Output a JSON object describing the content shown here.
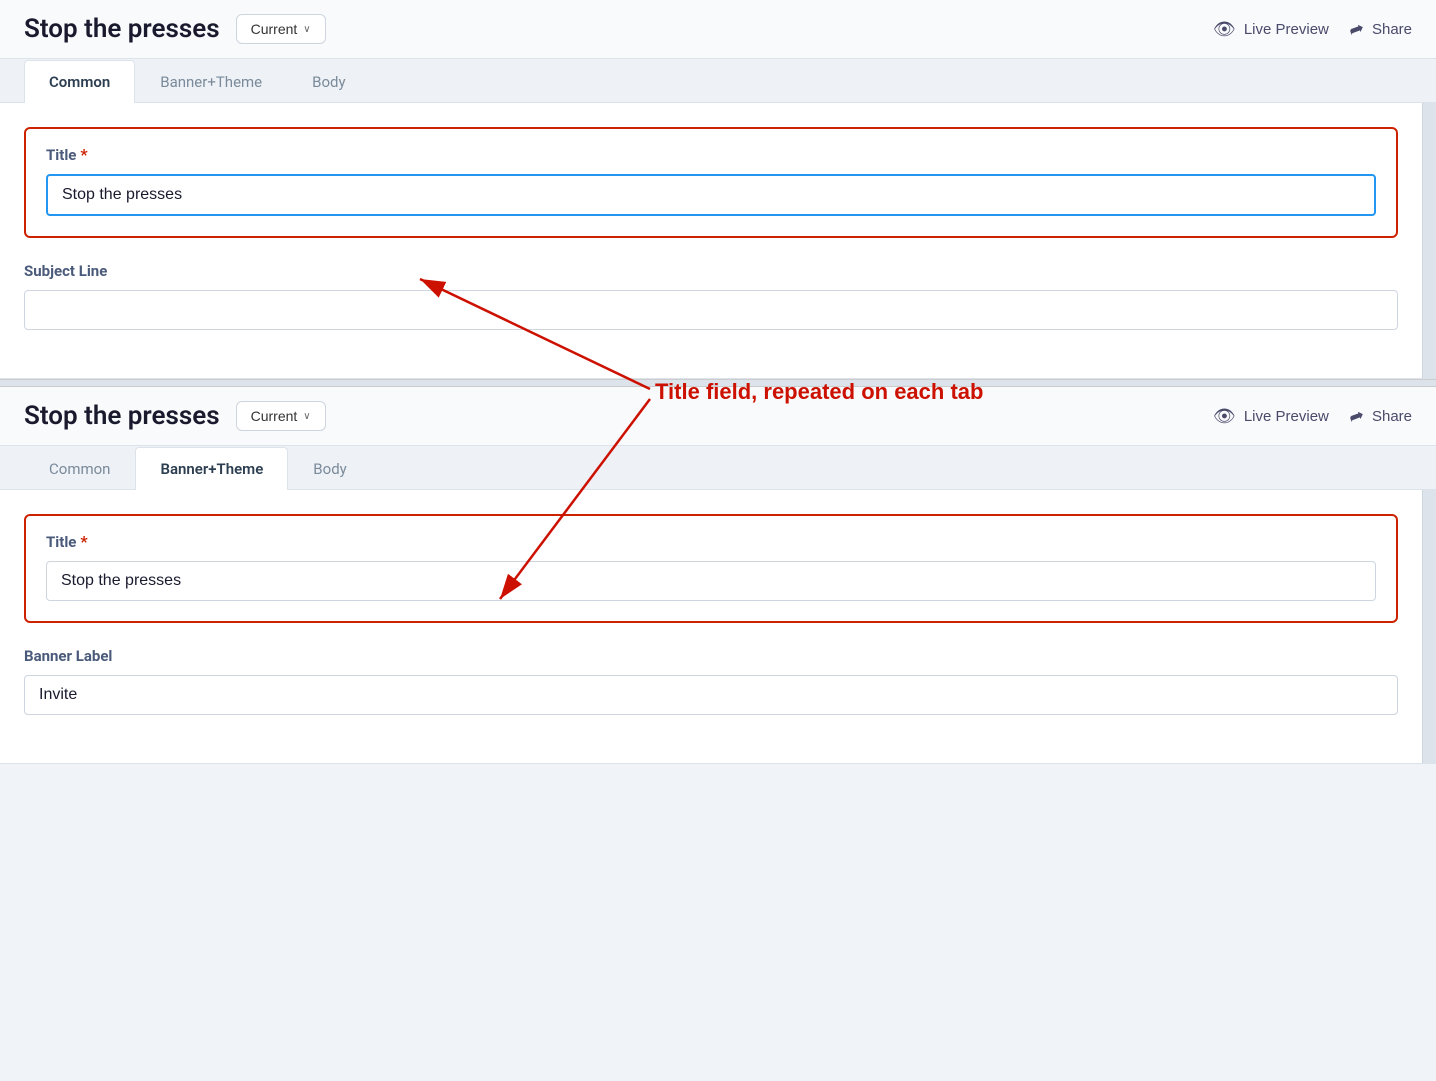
{
  "app": {
    "title": "Stop the presses",
    "version_label": "Current",
    "live_preview_label": "Live Preview",
    "share_label": "Share"
  },
  "tabs": {
    "top_panel": [
      {
        "id": "common",
        "label": "Common",
        "active": true
      },
      {
        "id": "banner_theme",
        "label": "Banner+Theme",
        "active": false
      },
      {
        "id": "body",
        "label": "Body",
        "active": false
      }
    ],
    "bottom_panel": [
      {
        "id": "common",
        "label": "Common",
        "active": false
      },
      {
        "id": "banner_theme",
        "label": "Banner+Theme",
        "active": true
      },
      {
        "id": "body",
        "label": "Body",
        "active": false
      }
    ]
  },
  "top_panel": {
    "title_field": {
      "label": "Title",
      "required": true,
      "value": "Stop the presses",
      "placeholder": ""
    },
    "subject_line_field": {
      "label": "Subject Line",
      "required": false,
      "value": "",
      "placeholder": ""
    }
  },
  "bottom_panel": {
    "title_field": {
      "label": "Title",
      "required": true,
      "value": "Stop the presses",
      "placeholder": ""
    },
    "banner_label_field": {
      "label": "Banner Label",
      "required": false,
      "value": "Invite",
      "placeholder": ""
    }
  },
  "annotation": {
    "text": "Title field, repeated on each tab"
  },
  "icons": {
    "eye": "👁",
    "share": "➦",
    "chevron": "∨"
  }
}
